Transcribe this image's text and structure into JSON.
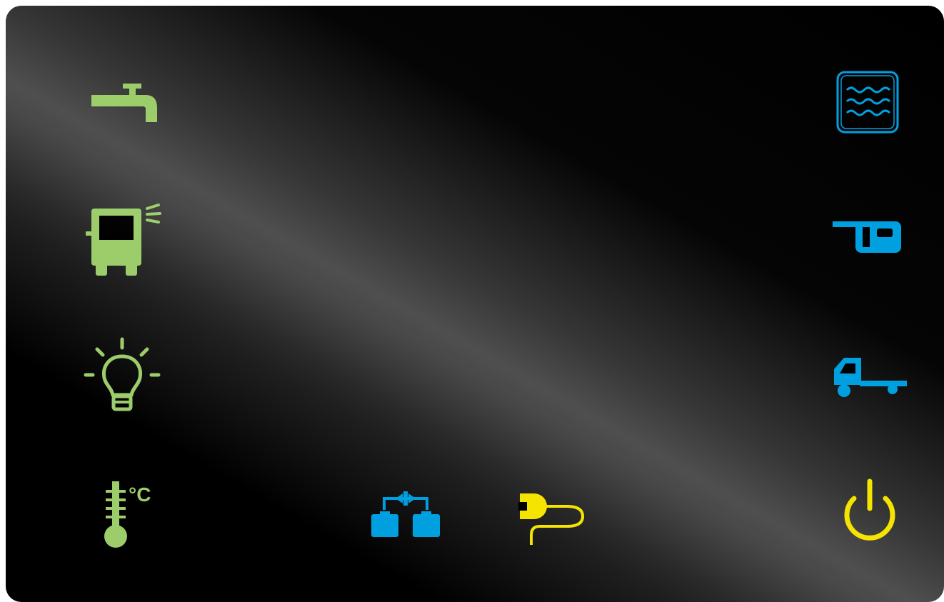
{
  "colors": {
    "green": "#9ccd6a",
    "blue": "#00a0e0",
    "yellow": "#f5e300",
    "panel": "#000000"
  },
  "controls": {
    "tap": {
      "icon": "water-tap-icon"
    },
    "motorhome_lights": {
      "icon": "motorhome-front-icon"
    },
    "light": {
      "icon": "light-bulb-icon"
    },
    "temperature": {
      "icon": "thermometer-icon",
      "unit": "°C"
    },
    "water_tank": {
      "icon": "water-tank-icon"
    },
    "caravan": {
      "icon": "caravan-icon"
    },
    "tow_vehicle": {
      "icon": "truck-icon"
    },
    "power": {
      "icon": "power-icon"
    },
    "battery_link": {
      "icon": "battery-link-icon"
    },
    "shore_power": {
      "icon": "plug-icon"
    }
  }
}
